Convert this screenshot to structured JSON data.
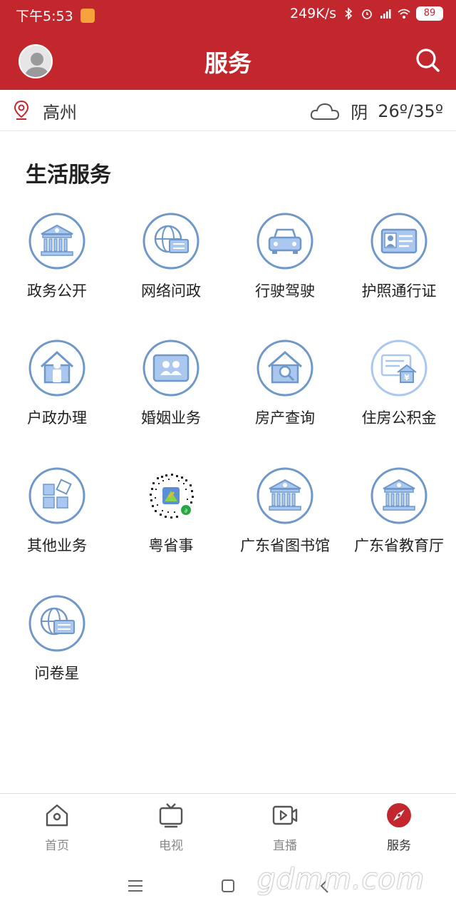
{
  "status_bar": {
    "time": "下午5:53",
    "net_speed": "249K/s",
    "battery": "89"
  },
  "header": {
    "title": "服务"
  },
  "location": {
    "city": "高州",
    "weather": "阴",
    "temperature": "26º/35º"
  },
  "section": {
    "title": "生活服务"
  },
  "services": [
    {
      "label": "政务公开",
      "icon": "government-building-icon"
    },
    {
      "label": "网络问政",
      "icon": "globe-chat-icon"
    },
    {
      "label": "行驶驾驶",
      "icon": "car-icon"
    },
    {
      "label": "护照通行证",
      "icon": "id-card-icon"
    },
    {
      "label": "户政办理",
      "icon": "house-person-icon"
    },
    {
      "label": "婚姻业务",
      "icon": "couple-icon"
    },
    {
      "label": "房产查询",
      "icon": "house-search-icon"
    },
    {
      "label": "住房公积金",
      "icon": "housing-fund-icon"
    },
    {
      "label": "其他业务",
      "icon": "blocks-icon"
    },
    {
      "label": "粤省事",
      "icon": "mini-program-qr-icon"
    },
    {
      "label": "广东省图书馆",
      "icon": "library-building-icon"
    },
    {
      "label": "广东省教育厅",
      "icon": "education-building-icon"
    },
    {
      "label": "问卷星",
      "icon": "survey-globe-icon"
    }
  ],
  "tabbar": {
    "items": [
      {
        "label": "首页",
        "icon": "home-icon"
      },
      {
        "label": "电视",
        "icon": "tv-icon"
      },
      {
        "label": "直播",
        "icon": "live-video-icon"
      },
      {
        "label": "服务",
        "icon": "compass-icon"
      }
    ],
    "active": 3
  },
  "watermark": "gdmm.com",
  "colors": {
    "brand_red": "#c1272d",
    "icon_blue": "#6f98c9",
    "icon_fill": "#a9c7ef"
  }
}
